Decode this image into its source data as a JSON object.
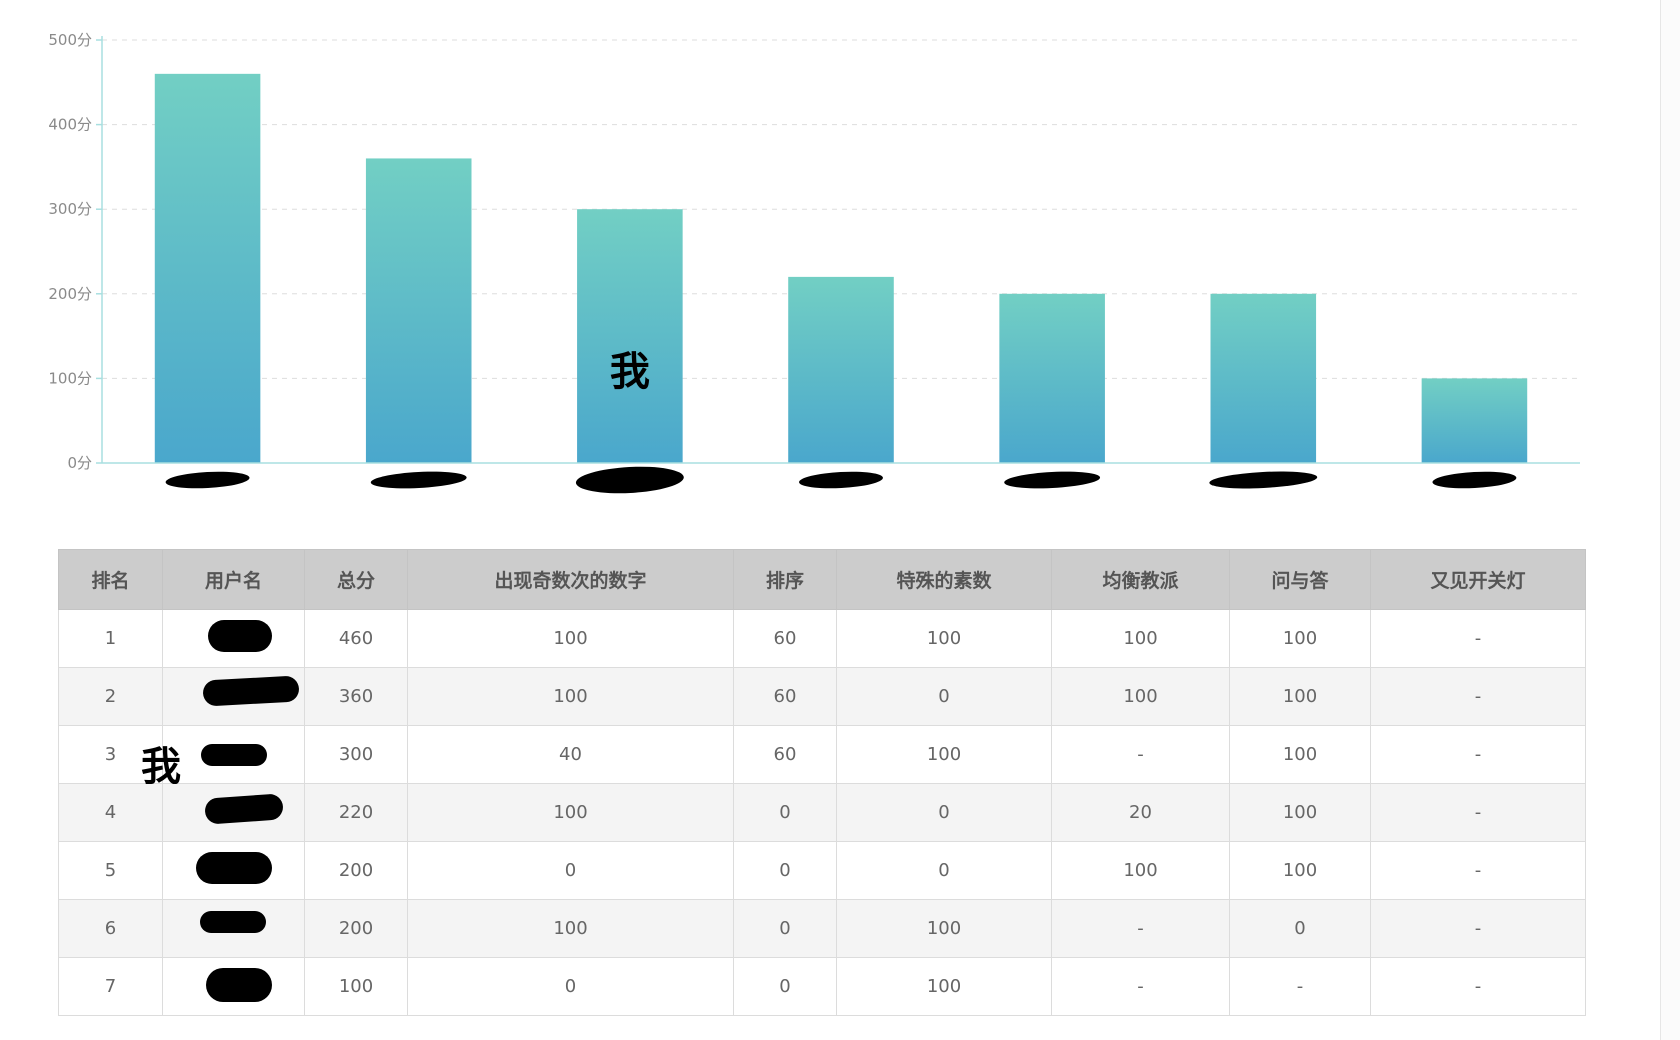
{
  "chart_data": {
    "type": "bar",
    "categories": [
      "",
      "",
      "",
      "",
      "",
      "",
      ""
    ],
    "values": [
      460,
      360,
      300,
      220,
      200,
      200,
      100
    ],
    "y_ticks": [
      "0分",
      "100分",
      "200分",
      "300分",
      "400分",
      "500分"
    ],
    "ylim": [
      0,
      500
    ],
    "grid": true,
    "annotation": "我",
    "annotation_index": 2,
    "colors": {
      "bar_top": "#72cfc4",
      "bar_bottom": "#4aa7cc",
      "axis": "#a8dfe0",
      "grid": "#dddddd"
    }
  },
  "table": {
    "headers": [
      "排名",
      "用户名",
      "总分",
      "出现奇数次的数字",
      "排序",
      "特殊的素数",
      "均衡教派",
      "问与答",
      "又见开关灯"
    ],
    "rows": [
      [
        "1",
        "",
        "460",
        "100",
        "60",
        "100",
        "100",
        "100",
        "-"
      ],
      [
        "2",
        "",
        "360",
        "100",
        "60",
        "0",
        "100",
        "100",
        "-"
      ],
      [
        "3",
        "",
        "300",
        "40",
        "60",
        "100",
        "-",
        "100",
        "-"
      ],
      [
        "4",
        "",
        "220",
        "100",
        "0",
        "0",
        "20",
        "100",
        "-"
      ],
      [
        "5",
        "",
        "200",
        "0",
        "0",
        "0",
        "100",
        "100",
        "-"
      ],
      [
        "6",
        "",
        "200",
        "100",
        "0",
        "100",
        "-",
        "0",
        "-"
      ],
      [
        "7",
        "",
        "100",
        "0",
        "0",
        "100",
        "-",
        "-",
        "-"
      ]
    ],
    "me_mark": "我"
  }
}
